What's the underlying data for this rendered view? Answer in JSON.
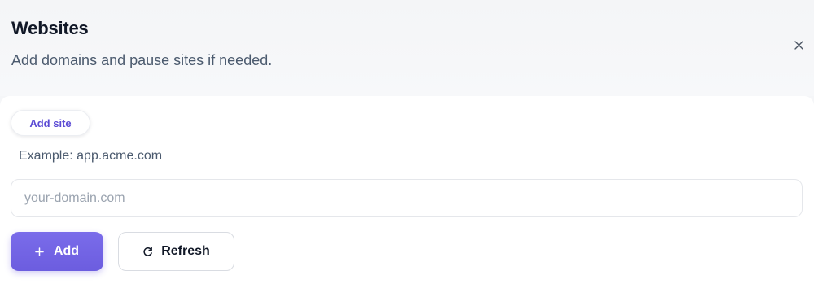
{
  "header": {
    "title": "Websites",
    "subtitle": "Add domains and pause sites if needed.",
    "close_icon": "close-icon"
  },
  "form": {
    "chip_label": "Add site",
    "hint": "Example: app.acme.com",
    "domain_input": {
      "value": "",
      "placeholder": "your-domain.com"
    },
    "add_button": {
      "label": "Add",
      "icon": "plus-icon"
    },
    "refresh_button": {
      "label": "Refresh",
      "icon": "refresh-icon"
    }
  },
  "colors": {
    "accent": "#6c5ddf",
    "chip_text": "#5b4bd4",
    "muted_text": "#4b5a6e",
    "title_text": "#111827"
  }
}
